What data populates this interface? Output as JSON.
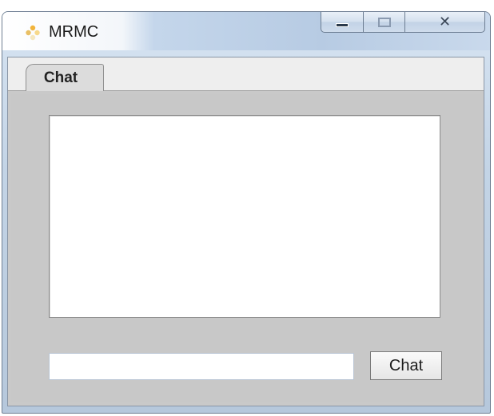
{
  "window": {
    "title": "MRMC",
    "controls": {
      "minimize_icon": "minimize-icon",
      "maximize_icon": "maximize-icon",
      "close_icon": "close-icon",
      "close_glyph": "✕"
    }
  },
  "tabs": [
    {
      "label": "Chat",
      "selected": true
    }
  ],
  "chat_panel": {
    "log_text": "",
    "input_value": "",
    "input_placeholder": "",
    "send_button_label": "Chat"
  },
  "colors": {
    "panel_background": "#c8c8c8",
    "tab_strip_background": "#eeeeee",
    "title_bar_accent": "#b7cbe3"
  }
}
